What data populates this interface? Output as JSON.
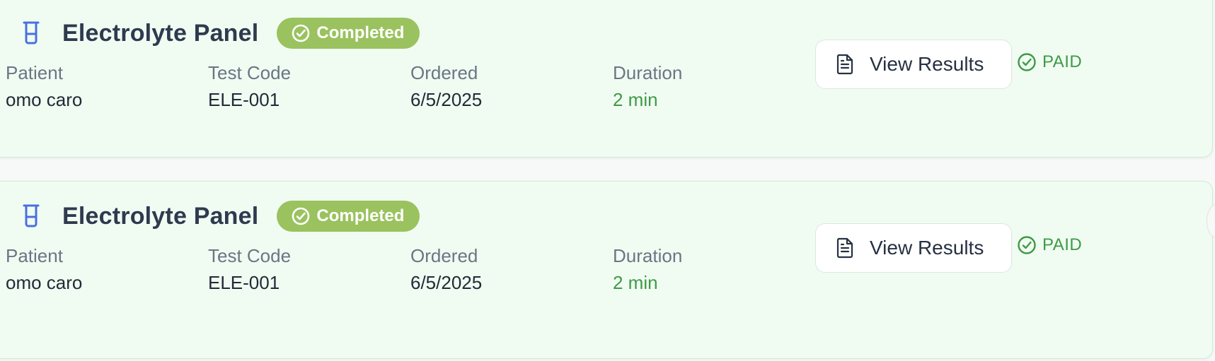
{
  "cards": [
    {
      "title": "Electrolyte Panel",
      "status": "Completed",
      "fields": [
        {
          "label": "Patient",
          "value": "omo caro"
        },
        {
          "label": "Test Code",
          "value": "ELE-001"
        },
        {
          "label": "Ordered",
          "value": "6/5/2025"
        },
        {
          "label": "Duration",
          "value": "2 min"
        }
      ],
      "action_label": "View Results",
      "payment_status": "PAID"
    },
    {
      "title": "Electrolyte Panel",
      "status": "Completed",
      "fields": [
        {
          "label": "Patient",
          "value": "omo caro"
        },
        {
          "label": "Test Code",
          "value": "ELE-001"
        },
        {
          "label": "Ordered",
          "value": "6/5/2025"
        },
        {
          "label": "Duration",
          "value": "2 min"
        }
      ],
      "action_label": "View Results",
      "payment_status": "PAID"
    }
  ],
  "colors": {
    "card_bg": "#f0fcf2",
    "badge_bg": "#9ac25e",
    "paid_green": "#3f9a45",
    "icon_blue": "#4a6fe0"
  },
  "icons": {
    "test": "test-tube-icon",
    "status": "check-circle-icon",
    "action": "document-icon",
    "paid": "check-circle-icon"
  }
}
